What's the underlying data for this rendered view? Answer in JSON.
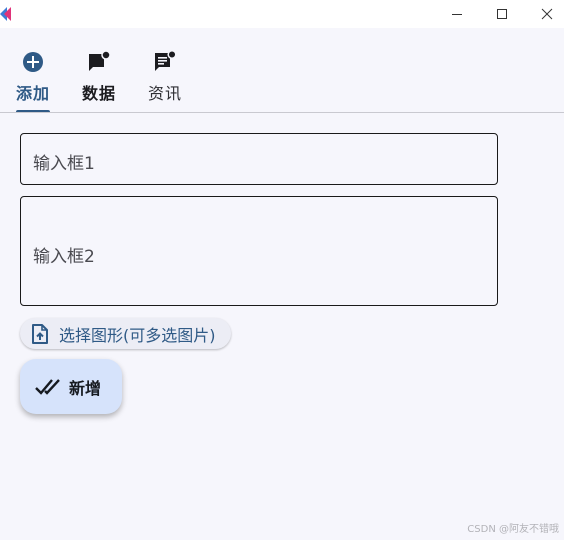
{
  "window": {
    "logo_icon": "app-logo-icon",
    "controls": [
      "minimize-icon",
      "maximize-icon",
      "close-icon"
    ]
  },
  "tabs": [
    {
      "label": "添加",
      "icon": "add-circle-icon",
      "state": "selected"
    },
    {
      "label": "数据",
      "icon": "chat-notification-icon"
    },
    {
      "label": "资讯",
      "icon": "message-list-icon"
    }
  ],
  "form": {
    "input1_placeholder": "输入框1",
    "input2_placeholder": "输入框2",
    "choose_file": {
      "label": "选择图形(可多选图片)",
      "icon": "file-upload-icon"
    },
    "add_button": {
      "label": "新增",
      "icon": "done-all-icon"
    }
  },
  "watermark": "CSDN @阿友不错哦",
  "colors": {
    "accent": "#2f5a86",
    "background": "#f6f6fc",
    "add_button_bg": "#d6e3fb",
    "chip_bg": "#ecedf5"
  }
}
